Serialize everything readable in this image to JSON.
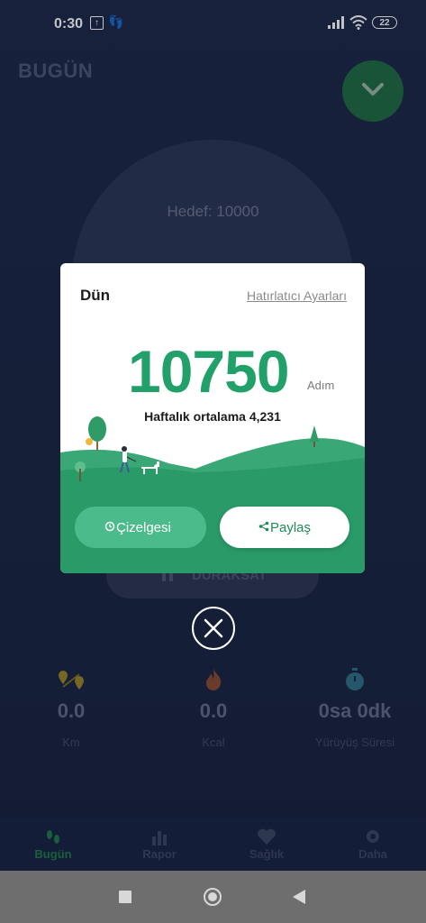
{
  "status_bar": {
    "time": "0:30",
    "battery": "22"
  },
  "page": {
    "title": "BUGÜN",
    "target": "Hedef: 10000",
    "pause_label": "DURAKSAT"
  },
  "stats": [
    {
      "value": "0.0",
      "unit": "Km",
      "icon": "location-route-icon"
    },
    {
      "value": "0.0",
      "unit": "Kcal",
      "icon": "flame-icon"
    },
    {
      "value": "0sa 0dk",
      "unit": "Yürüyüş Süresi",
      "icon": "stopwatch-icon"
    }
  ],
  "bottom_nav": [
    {
      "label": "Bugün",
      "icon": "footsteps-icon",
      "active": true
    },
    {
      "label": "Rapor",
      "icon": "bar-chart-icon",
      "active": false
    },
    {
      "label": "Sağlık",
      "icon": "heart-icon",
      "active": false
    },
    {
      "label": "Daha",
      "icon": "gear-icon",
      "active": false
    }
  ],
  "modal": {
    "title": "Dün",
    "reminder_link": "Hatırlatıcı Ayarları",
    "steps": "10750",
    "steps_unit": "Adım",
    "weekly_average": "Haftalık ortalama 4,231",
    "chart_button": "Çizelgesi",
    "share_button": "Paylaş"
  },
  "colors": {
    "accent": "#22a06a",
    "fab": "#1f6b41",
    "background": "#1b2745"
  }
}
